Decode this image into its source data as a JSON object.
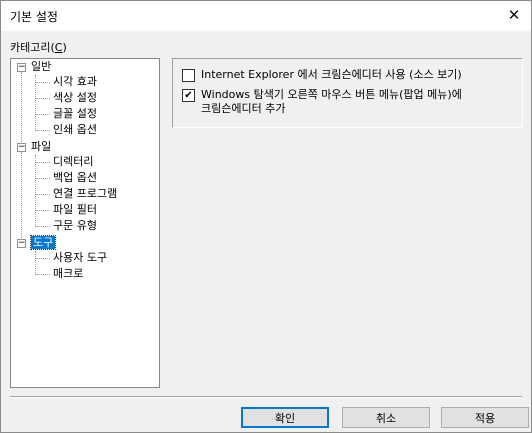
{
  "window": {
    "title": "기본 설정",
    "close_glyph": "✕"
  },
  "category": {
    "label_prefix": "카테고리(",
    "mnemonic": "C",
    "label_suffix": ")"
  },
  "tree": {
    "general": {
      "label": "일반",
      "children": [
        "시각 효과",
        "색상 설정",
        "글꼴 설정",
        "인쇄 옵션"
      ]
    },
    "file": {
      "label": "파일",
      "children": [
        "디렉터리",
        "백업 옵션",
        "연결 프로그램",
        "파일 필터",
        "구문 유형"
      ]
    },
    "tools": {
      "label": "도구",
      "children": [
        "사용자 도구",
        "매크로"
      ]
    },
    "expander_glyph": "−"
  },
  "options": {
    "ie_source": {
      "label": "Internet Explorer 에서 크림슨에디터 사용 (소스 보기)",
      "checked": false
    },
    "explorer_menu": {
      "line1": "Windows 탐색기 오른쪽 마우스 버튼 메뉴(팝업 메뉴)에",
      "line2": "크림슨에디터 추가",
      "checked": true,
      "check_glyph": "✔"
    }
  },
  "buttons": {
    "ok": "확인",
    "cancel": "취소",
    "apply": "적용"
  }
}
